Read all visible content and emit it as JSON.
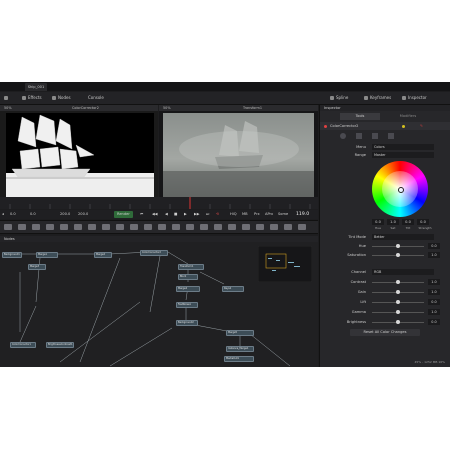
{
  "app": {
    "tab_label": "Ship_001",
    "toolbar": {
      "effects": "Effects",
      "nodes": "Nodes",
      "console": "Console",
      "spline": "Spline",
      "keyframes": "Keyframes",
      "inspector": "Inspector"
    },
    "viewers": [
      {
        "zoom": "50%",
        "name": "ColorCorrector2"
      },
      {
        "zoom": "50%",
        "name": "Transform1"
      }
    ],
    "transport": {
      "start": "0.0",
      "render_start": "0.0",
      "render_end": "200.0",
      "end": "200.0",
      "render_label": "Render",
      "hiq": "HiQ",
      "mb": "MB",
      "prx": "Prx",
      "aprx": "APrx",
      "some": "Some",
      "current_frame": "119.0"
    },
    "nodes_panel": {
      "title": "Nodes",
      "nodes": [
        "Background1",
        "Merge1",
        "Merge2",
        "Merge3",
        "ColorCorrector2",
        "Transform1",
        "Blur1",
        "Merge4",
        "Rays1",
        "FastNoise1",
        "Background2",
        "Merge5",
        "ColorCorrector1",
        "BrightnessContrast1",
        "Instance_Merge1",
        "MediaOut1"
      ]
    },
    "inspector": {
      "title": "Inspector",
      "tabs": [
        "Tools",
        "Modifiers"
      ],
      "tool_name": "ColorCorrector2",
      "menu_label": "Menu",
      "menu_value": "Colors",
      "range_label": "Range",
      "range_value": "Master",
      "wheel_values": [
        {
          "label": "Hue",
          "value": "0.0"
        },
        {
          "label": "Sat",
          "value": "1.0"
        },
        {
          "label": "Tilt",
          "value": "0.0"
        },
        {
          "label": "Strength",
          "value": "0.0"
        }
      ],
      "tint_label": "Tint Mode",
      "tint_value": "Better",
      "hue_label": "Hue",
      "hue_value": "0.0",
      "sat_label": "Saturation",
      "sat_value": "1.0",
      "channel_label": "Channel",
      "channel_value": "RGB",
      "sliders": [
        {
          "label": "Contrast",
          "value": "1.0"
        },
        {
          "label": "Gain",
          "value": "1.0"
        },
        {
          "label": "Lift",
          "value": "0.0"
        },
        {
          "label": "Gamma",
          "value": "1.0"
        },
        {
          "label": "Brightness",
          "value": "0.0"
        }
      ],
      "reset_label": "Reset All Color Changes"
    },
    "statusbar": "45% - 1252 MB   16%"
  }
}
